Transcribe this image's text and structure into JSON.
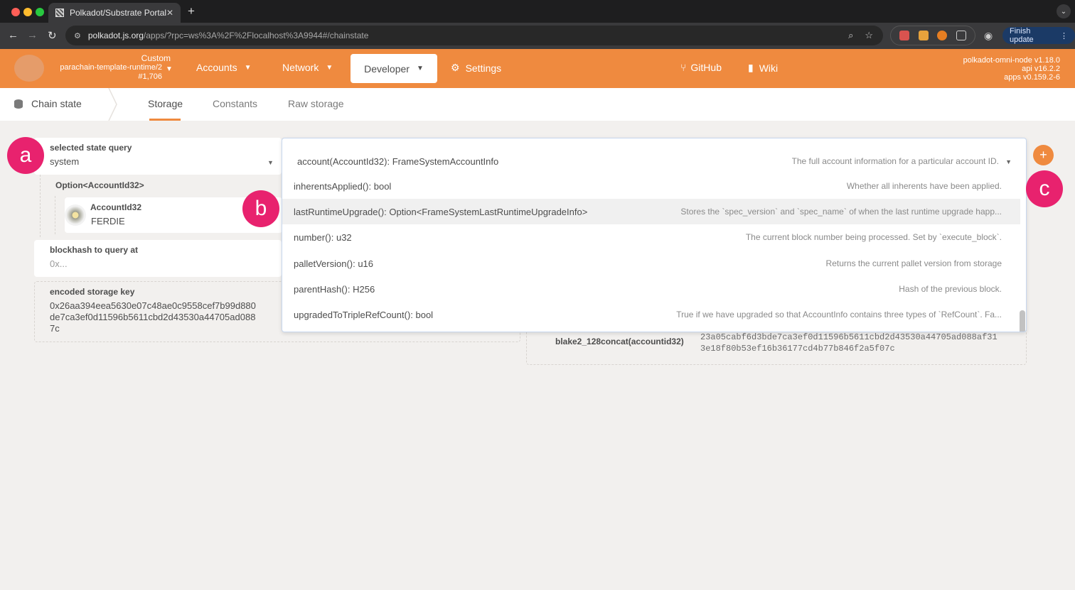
{
  "browser": {
    "tab_title": "Polkadot/Substrate Portal",
    "tab_close": "✕",
    "new_tab": "+",
    "url_host": "polkadot.js.org",
    "url_path": "/apps/?rpc=ws%3A%2F%2Flocalhost%3A9944#/chainstate",
    "finish_update": "Finish update"
  },
  "header": {
    "chain_custom": "Custom",
    "chain_name": "parachain-template-runtime/2",
    "chain_block": "#1,706",
    "nav": {
      "accounts": "Accounts",
      "network": "Network",
      "developer": "Developer",
      "settings": "Settings",
      "github": "GitHub",
      "wiki": "Wiki"
    },
    "node": {
      "name": "polkadot-omni-node v1.18.0",
      "api": "api v16.2.2",
      "apps": "apps v0.159.2-6"
    },
    "accent_color": "#ef8a3f"
  },
  "subnav": {
    "section": "Chain state",
    "tabs": [
      "Storage",
      "Constants",
      "Raw storage"
    ]
  },
  "query": {
    "selected_label": "selected state query",
    "selected_value": "system",
    "param_type": "Option<AccountId32>",
    "account_label": "AccountId32",
    "account_value": "FERDIE",
    "blockhash_label": "blockhash to query at",
    "blockhash_placeholder": "0x...",
    "encoded_label": "encoded storage key",
    "encoded_value_1": "0x26aa394eea5630e07c48ae0c9558cef7b99d880",
    "encoded_value_2": "de7ca3ef0d11596b5611cbd2d43530a44705ad088",
    "encoded_value_3": "7c",
    "hasher_label": "blake2_128concat(accountid32)",
    "hasher_value_1": "23a05cabf6d3bde7ca3ef0d11596b5611cbd2d43530a44705ad088af31",
    "hasher_value_2": "3e18f80b53ef16b36177cd4b77b846f2a5f07c"
  },
  "menu": {
    "selected": {
      "sig": "account(AccountId32): FrameSystemAccountInfo",
      "doc": "The full account information for a particular account ID."
    },
    "items": [
      {
        "sig": "inherentsApplied(): bool",
        "doc": "Whether all inherents have been applied."
      },
      {
        "sig": "lastRuntimeUpgrade(): Option<FrameSystemLastRuntimeUpgradeInfo>",
        "doc": "Stores the `spec_version` and `spec_name` of when the last runtime upgrade happ..."
      },
      {
        "sig": "number(): u32",
        "doc": "The current block number being processed. Set by `execute_block`."
      },
      {
        "sig": "palletVersion(): u16",
        "doc": "Returns the current pallet version from storage"
      },
      {
        "sig": "parentHash(): H256",
        "doc": "Hash of the previous block."
      },
      {
        "sig": "upgradedToTripleRefCount(): bool",
        "doc": "True if we have upgraded so that AccountInfo contains three types of `RefCount`. Fa..."
      }
    ]
  },
  "annotations": {
    "a": "a",
    "b": "b",
    "c": "c",
    "color": "#e8226e"
  },
  "add_button": "+"
}
